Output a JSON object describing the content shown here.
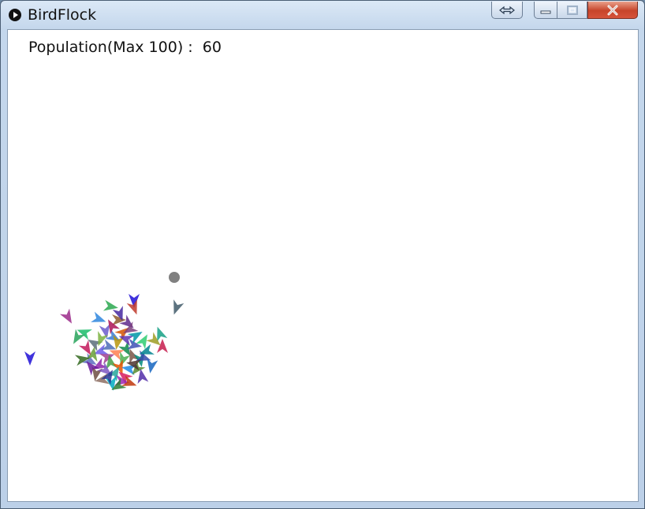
{
  "window": {
    "title": "BirdFlock"
  },
  "canvas": {
    "population_label": "Population(Max 100) :",
    "population_value": "60",
    "obstacle_color": "#808080",
    "bird_colors": [
      "#1f0fd6",
      "#9b2a8a",
      "#2aa84f",
      "#1f0fd6",
      "#415a6a",
      "#c0392b",
      "#2e86de",
      "#8e5a2b",
      "#5f2a8c",
      "#1abc6a",
      "#27a35b",
      "#6a5acd",
      "#3a7bd5",
      "#d35400",
      "#7b3f7f",
      "#2ecc71",
      "#16a085",
      "#c71c4e",
      "#5a6e7a",
      "#6c5ce7",
      "#4b6cb7",
      "#b7950b",
      "#0e8a4a",
      "#3f51b5",
      "#a0408f",
      "#ff7f50",
      "#4caf50",
      "#795548",
      "#00897b",
      "#5c6bc0",
      "#8e24aa",
      "#43a047",
      "#e65100",
      "#1e88e5",
      "#6d4c41",
      "#7e57c2",
      "#26a69a",
      "#d81b60",
      "#558b2f",
      "#3949ab",
      "#8d6e63",
      "#00acc1",
      "#9c27b0",
      "#689f38",
      "#c2185b",
      "#5e35b1",
      "#0097a7",
      "#7cb342",
      "#ad1457",
      "#4527a0",
      "#00838f",
      "#9e9d24",
      "#6a1b9a",
      "#283593",
      "#2e7d32",
      "#bf360c",
      "#512da8",
      "#1565c0",
      "#33691e",
      "#4e342e"
    ]
  },
  "title_buttons": {
    "resize_icon": "double-arrow-icon",
    "minimize_icon": "minimize-icon",
    "maximize_icon": "maximize-icon",
    "close_icon": "close-icon"
  }
}
